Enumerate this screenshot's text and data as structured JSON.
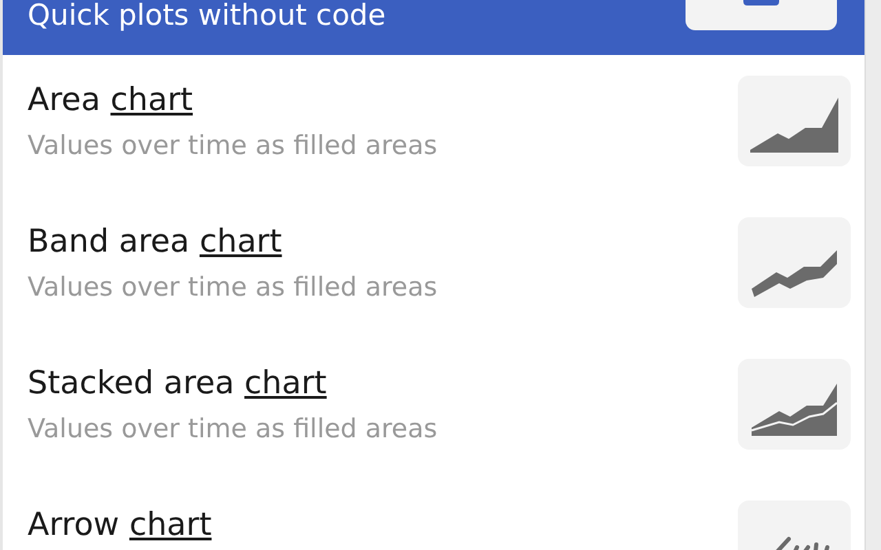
{
  "header": {
    "title": "Quick plots without code"
  },
  "items": [
    {
      "kind": "area",
      "title": "Area",
      "link": "chart",
      "description": "Values over time as filled areas"
    },
    {
      "kind": "band",
      "title": "Band area",
      "link": "chart",
      "description": "Values over time as filled areas"
    },
    {
      "kind": "stacked",
      "title": "Stacked area",
      "link": "chart",
      "description": "Values over time as filled areas"
    },
    {
      "kind": "arrow",
      "title": "Arrow",
      "link": "chart"
    }
  ]
}
